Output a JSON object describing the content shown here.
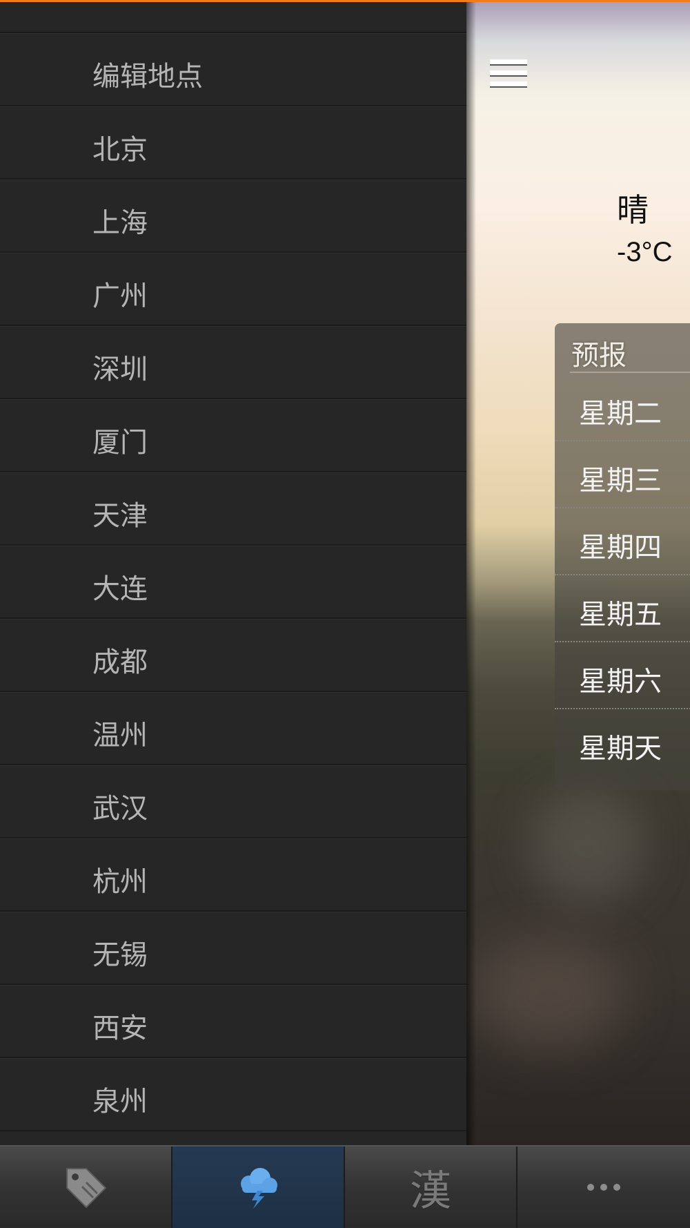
{
  "sidebar": {
    "items": [
      {
        "label": "编辑地点"
      },
      {
        "label": "北京"
      },
      {
        "label": "上海"
      },
      {
        "label": "广州"
      },
      {
        "label": "深圳"
      },
      {
        "label": "厦门"
      },
      {
        "label": "天津"
      },
      {
        "label": "大连"
      },
      {
        "label": "成都"
      },
      {
        "label": "温州"
      },
      {
        "label": "武汉"
      },
      {
        "label": "杭州"
      },
      {
        "label": "无锡"
      },
      {
        "label": "西安"
      },
      {
        "label": "泉州"
      }
    ]
  },
  "weather": {
    "condition": "晴",
    "temperature": "-3°C"
  },
  "forecast": {
    "title": "预报",
    "days": [
      {
        "day": "星期二"
      },
      {
        "day": "星期三"
      },
      {
        "day": "星期四"
      },
      {
        "day": "星期五"
      },
      {
        "day": "星期六"
      },
      {
        "day": "星期天"
      }
    ]
  },
  "tabbar": {
    "tabs": [
      {
        "icon": "tag-icon"
      },
      {
        "icon": "storm-cloud-icon"
      },
      {
        "label": "漢"
      },
      {
        "icon": "more-icon"
      }
    ],
    "active_index": 1
  },
  "colors": {
    "accent": "#f07d1a",
    "active_tab": "#253a52",
    "sidebar_bg": "#262626"
  }
}
